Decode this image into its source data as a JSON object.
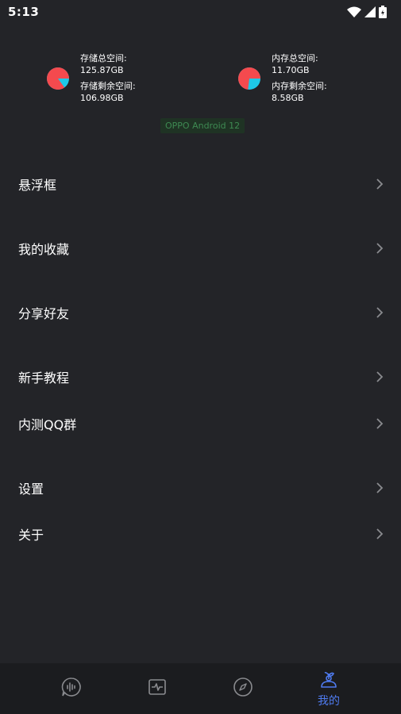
{
  "status_bar": {
    "time": "5:13"
  },
  "storage": {
    "left": {
      "total_label": "存储总空间:",
      "total_value": "125.87GB",
      "free_label": "存储剩余空间:",
      "free_value": "106.98GB",
      "used_fraction": 0.15
    },
    "right": {
      "total_label": "内存总空间:",
      "total_value": "11.70GB",
      "free_label": "内存剩余空间:",
      "free_value": "8.58GB",
      "used_fraction": 0.27
    },
    "colors": {
      "used": "#f44a4e",
      "free": "#1ec9e8"
    }
  },
  "device": {
    "label": "OPPO Android 12"
  },
  "menu": {
    "items": [
      {
        "label": "悬浮框"
      },
      {
        "label": "我的收藏"
      },
      {
        "label": "分享好友"
      },
      {
        "label": "新手教程"
      },
      {
        "label": "内测QQ群"
      },
      {
        "label": "设置"
      },
      {
        "label": "关于"
      }
    ]
  },
  "bottom_nav": {
    "items": [
      {
        "icon": "voice-bubble-icon",
        "label": ""
      },
      {
        "icon": "pulse-monitor-icon",
        "label": ""
      },
      {
        "icon": "compass-icon",
        "label": ""
      },
      {
        "icon": "profile-plant-icon",
        "label": "我的",
        "active": true
      }
    ],
    "active_color": "#4f7bf0"
  }
}
